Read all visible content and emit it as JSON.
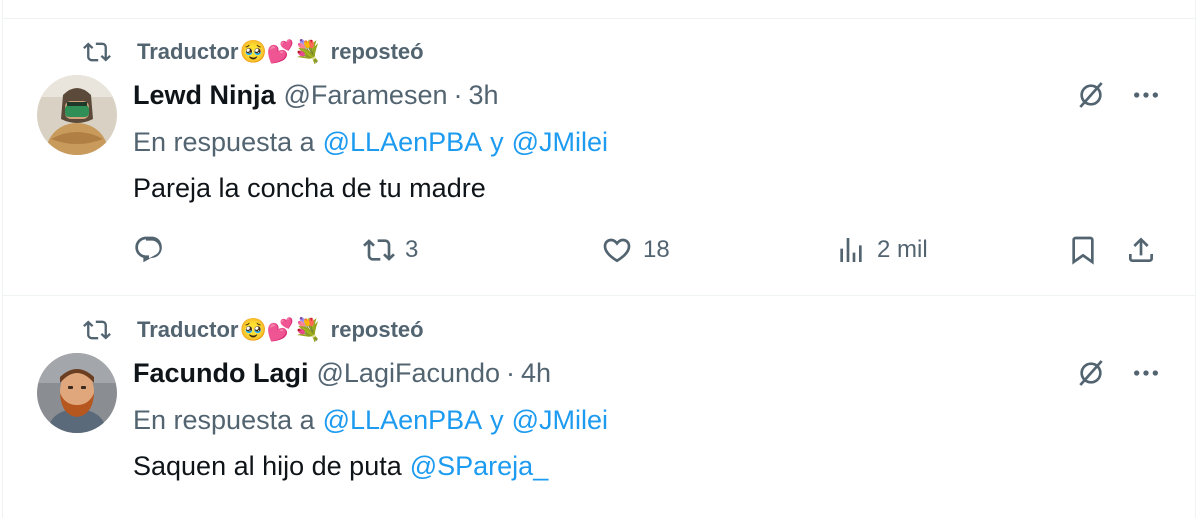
{
  "tweets": [
    {
      "repost": {
        "user": "Traductor",
        "emojis": "🥹💕💐",
        "suffix": "reposteó"
      },
      "author": {
        "name": "Lewd Ninja",
        "handle": "@Faramesen",
        "separator": "·",
        "time": "3h"
      },
      "reply": {
        "prefix": "En respuesta a",
        "mention1": "@LLAenPBA",
        "conj": "y",
        "mention2": "@JMilei"
      },
      "text": "Pareja la concha de tu madre",
      "text_mention": "",
      "stats": {
        "replies": "",
        "reposts": "3",
        "likes": "18",
        "views": "2 mil"
      }
    },
    {
      "repost": {
        "user": "Traductor",
        "emojis": "🥹💕💐",
        "suffix": "reposteó"
      },
      "author": {
        "name": "Facundo Lagi",
        "handle": "@LagiFacundo",
        "separator": "·",
        "time": "4h"
      },
      "reply": {
        "prefix": "En respuesta a",
        "mention1": "@LLAenPBA",
        "conj": "y",
        "mention2": "@JMilei"
      },
      "text": "Saquen al hijo de puta",
      "text_mention": "@SPareja_"
    }
  ],
  "icons": {
    "repost": "repost-icon",
    "grok": "grok-icon",
    "more": "more-icon",
    "reply": "reply-icon",
    "like": "heart-icon",
    "views": "views-icon",
    "bookmark": "bookmark-icon",
    "share": "share-icon"
  },
  "colors": {
    "text": "#0f1419",
    "secondary": "#536471",
    "link": "#1d9bf0",
    "border": "#eff3f4"
  }
}
